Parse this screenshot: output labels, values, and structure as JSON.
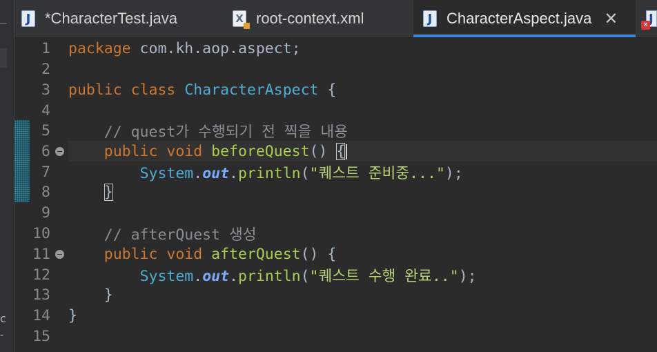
{
  "tabs": [
    {
      "label": "*CharacterTest.java",
      "icon": "java-file-icon",
      "active": false
    },
    {
      "label": "root-context.xml",
      "icon": "xml-file-icon",
      "active": false
    },
    {
      "label": "CharacterAspect.java",
      "icon": "java-file-icon",
      "active": true
    }
  ],
  "left_strip": {
    "glyph": "c",
    "dash": "-"
  },
  "colors": {
    "keyword": "#cc7832",
    "class_name": "#4eadd5",
    "comment": "#8a8f93",
    "method": "#a8cf4f",
    "string": "#b5d376",
    "static_field": "#79abff",
    "plain": "#a9b7c6",
    "active_tab_underline": "#3d83d6"
  },
  "code": {
    "l1": {
      "num": "1",
      "kw": "package",
      "rest": " com.kh.aop.aspect;"
    },
    "l2": {
      "num": "2"
    },
    "l3": {
      "num": "3",
      "kw1": "public",
      "kw2": "class",
      "cls": "CharacterAspect",
      "rest": " {"
    },
    "l4": {
      "num": "4"
    },
    "l5": {
      "num": "5",
      "comment": "// quest가 수행되기 전 찍을 내용"
    },
    "l6": {
      "num": "6",
      "kw1": "public",
      "kw2": "void",
      "fn": "beforeQuest",
      "rest": "() ",
      "brace": "{"
    },
    "l7": {
      "num": "7",
      "cls": "System",
      "out": "out",
      "fn": "println",
      "str": "\"퀘스트 준비중...\"",
      "rest": ");"
    },
    "l8": {
      "num": "8",
      "brace": "}"
    },
    "l9": {
      "num": "9"
    },
    "l10": {
      "num": "10",
      "comment": "// afterQuest 생성"
    },
    "l11": {
      "num": "11",
      "kw1": "public",
      "kw2": "void",
      "fn": "afterQuest",
      "rest": "() {"
    },
    "l12": {
      "num": "12",
      "cls": "System",
      "out": "out",
      "fn": "println",
      "str": "\"퀘스트 수행 완료..\"",
      "rest": ");"
    },
    "l13": {
      "num": "13",
      "brace": "}"
    },
    "l14": {
      "num": "14",
      "brace": "}"
    },
    "l15": {
      "num": "15"
    }
  }
}
